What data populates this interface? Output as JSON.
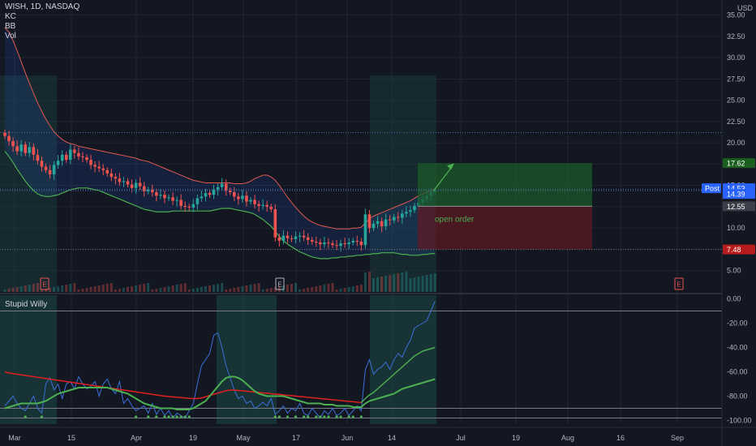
{
  "header": {
    "title": "WISH, 1D, NASDAQ",
    "indicators": [
      "KC",
      "BB",
      "Vol"
    ],
    "currency": "USD"
  },
  "oscillator": {
    "title": "Stupid Willy"
  },
  "annotations": {
    "open_order": "open order",
    "earnings_marker": "E"
  },
  "colors": {
    "background": "#131722",
    "up": "#26a69a",
    "down": "#ef5350",
    "bb_upper": "#e05a4f",
    "kc_lower": "#4caf50",
    "willy_line": "#3a6fd8",
    "willy_ma_red": "#e02020",
    "willy_ma_green": "#4caf50",
    "profit_zone": "#1c5a2a",
    "loss_zone": "#5c1a22",
    "tag_last": "#2962ff",
    "tag_target": "#1b5e20",
    "tag_stop": "#b71c1c",
    "tag_entry": "#3b3f49"
  },
  "chart_data": [
    {
      "type": "candlestick",
      "title": "WISH, 1D, NASDAQ",
      "ylabel": "USD",
      "ylim": [
        2.5,
        36
      ],
      "x_tick_labels": [
        "Mar",
        "15",
        "Apr",
        "19",
        "May",
        "17",
        "Jun",
        "14",
        "Jul",
        "19",
        "Aug",
        "16",
        "Sep"
      ],
      "y_tick_labels": [
        "35.00",
        "32.50",
        "30.00",
        "27.50",
        "25.00",
        "22.50",
        "20.00",
        "17.50",
        "15.00",
        "12.50",
        "10.00",
        "7.50",
        "5.00"
      ],
      "price_tags": [
        {
          "label": "Post",
          "value": "14.53"
        },
        {
          "label": "",
          "value": "14.39"
        },
        {
          "label": "",
          "value": "17.62"
        },
        {
          "label": "",
          "value": "12.55"
        },
        {
          "label": "",
          "value": "7.48"
        }
      ],
      "close": [
        20.8,
        20.2,
        19.6,
        19.0,
        19.8,
        18.8,
        19.5,
        18.6,
        17.9,
        17.2,
        16.8,
        16.3,
        17.4,
        17.9,
        18.6,
        18.0,
        19.2,
        18.8,
        18.4,
        18.3,
        18.0,
        17.4,
        17.2,
        17.0,
        16.8,
        16.4,
        16.0,
        15.8,
        15.4,
        15.5,
        15.1,
        14.7,
        15.3,
        14.9,
        14.3,
        14.5,
        14.2,
        13.8,
        13.9,
        13.5,
        13.6,
        13.2,
        13.3,
        12.6,
        12.5,
        12.4,
        12.8,
        13.5,
        13.7,
        14.1,
        13.9,
        14.5,
        14.8,
        15.2,
        14.4,
        14.2,
        13.7,
        13.4,
        13.8,
        13.1,
        13.3,
        12.8,
        12.6,
        12.7,
        12.5,
        12.2,
        8.9,
        8.5,
        9.1,
        8.8,
        8.7,
        9.0,
        9.1,
        8.9,
        8.6,
        8.4,
        8.3,
        8.1,
        8.3,
        8.2,
        8.0,
        7.9,
        8.2,
        8.1,
        8.3,
        8.5,
        8.4,
        8.0,
        11.6,
        10.0,
        10.5,
        10.8,
        10.2,
        11.0,
        10.9,
        11.3,
        11.2,
        11.7,
        11.9,
        12.1,
        12.6,
        13.0,
        13.4,
        13.8,
        14.2,
        14.39
      ],
      "bb_upper": [
        33.5,
        33.0,
        32.0,
        30.8,
        29.5,
        28.2,
        27.0,
        25.8,
        24.7,
        23.7,
        22.8,
        22.0,
        21.3,
        20.8,
        20.4,
        20.1,
        19.9,
        19.8,
        19.6,
        19.5,
        19.4,
        19.3,
        19.2,
        19.1,
        19.0,
        18.9,
        18.8,
        18.7,
        18.6,
        18.5,
        18.4,
        18.3,
        18.2,
        18.0,
        17.9,
        17.8,
        17.6,
        17.4,
        17.2,
        17.0,
        16.8,
        16.6,
        16.4,
        16.2,
        16.0,
        15.8,
        15.6,
        15.5,
        15.4,
        15.3,
        15.3,
        15.3,
        15.3,
        15.3,
        15.3,
        15.3,
        15.2,
        15.2,
        15.2,
        15.3,
        15.5,
        15.8,
        16.0,
        16.2,
        16.2,
        16.0,
        15.6,
        15.0,
        14.3,
        13.6,
        13.0,
        12.4,
        11.9,
        11.4,
        11.0,
        10.7,
        10.5,
        10.3,
        10.2,
        10.1,
        10.0,
        9.9,
        9.9,
        9.9,
        9.9,
        10.0,
        10.0,
        10.1,
        10.6,
        11.1,
        11.4,
        11.6,
        11.8,
        12.0,
        12.2,
        12.4,
        12.6,
        12.8,
        13.0,
        13.2,
        13.5,
        13.8,
        14.0,
        14.2,
        14.4,
        14.6
      ],
      "kc_lower": [
        19.0,
        18.4,
        17.7,
        16.9,
        16.2,
        15.5,
        14.9,
        14.4,
        14.0,
        13.8,
        13.7,
        13.7,
        13.8,
        13.9,
        14.1,
        14.3,
        14.5,
        14.6,
        14.7,
        14.7,
        14.7,
        14.6,
        14.5,
        14.4,
        14.2,
        14.0,
        13.8,
        13.6,
        13.4,
        13.2,
        13.0,
        12.8,
        12.6,
        12.4,
        12.2,
        12.1,
        12.0,
        11.9,
        11.9,
        11.9,
        11.9,
        12.0,
        12.0,
        12.0,
        12.0,
        12.0,
        12.0,
        12.0,
        12.0,
        12.0,
        12.0,
        12.1,
        12.2,
        12.3,
        12.3,
        12.3,
        12.2,
        12.1,
        12.0,
        11.9,
        11.8,
        11.6,
        11.3,
        11.0,
        10.6,
        10.2,
        9.6,
        9.0,
        8.5,
        8.1,
        7.8,
        7.5,
        7.2,
        7.0,
        6.8,
        6.6,
        6.5,
        6.4,
        6.4,
        6.4,
        6.5,
        6.5,
        6.6,
        6.6,
        6.7,
        6.7,
        6.8,
        6.8,
        6.9,
        6.9,
        7.0,
        7.0,
        7.1,
        7.1,
        7.1,
        7.1,
        7.0,
        6.9,
        6.9,
        6.8,
        6.8,
        6.8,
        6.9,
        6.9,
        7.0,
        7.0
      ]
    },
    {
      "type": "line",
      "title": "Stupid Willy",
      "ylim": [
        -103,
        3
      ],
      "y_tick_labels": [
        "0.00",
        "-20.00",
        "-40.00",
        "-60.00",
        "-80.00",
        "-100.00"
      ],
      "series": [
        {
          "values": [
            -88,
            -84,
            -80,
            -86,
            -90,
            -92,
            -86,
            -80,
            -90,
            -94,
            -70,
            -65,
            -75,
            -70,
            -82,
            -70,
            -68,
            -74,
            -64,
            -70,
            -74,
            -72,
            -68,
            -80,
            -70,
            -66,
            -74,
            -78,
            -68,
            -86,
            -82,
            -88,
            -92,
            -90,
            -88,
            -94,
            -86,
            -95,
            -90,
            -96,
            -92,
            -98,
            -94,
            -96,
            -98,
            -92,
            -86,
            -70,
            -55,
            -50,
            -45,
            -30,
            -28,
            -40,
            -55,
            -65,
            -75,
            -82,
            -80,
            -86,
            -84,
            -90,
            -88,
            -85,
            -88,
            -82,
            -95,
            -92,
            -88,
            -94,
            -90,
            -92,
            -86,
            -94,
            -96,
            -90,
            -94,
            -98,
            -92,
            -95,
            -90,
            -96,
            -94,
            -90,
            -96,
            -92,
            -88,
            -92,
            -58,
            -50,
            -62,
            -58,
            -56,
            -52,
            -58,
            -50,
            -45,
            -48,
            -40,
            -34,
            -24,
            -22,
            -20,
            -18,
            -10,
            -2
          ]
        },
        {
          "values": [
            -90,
            -89,
            -88,
            -87,
            -86,
            -86,
            -86,
            -86,
            -86,
            -85,
            -84,
            -82,
            -80,
            -78,
            -77,
            -76,
            -75,
            -74,
            -73,
            -73,
            -73,
            -73,
            -73,
            -73,
            -73,
            -73,
            -74,
            -75,
            -76,
            -77,
            -78,
            -80,
            -82,
            -84,
            -86,
            -87,
            -88,
            -89,
            -90,
            -90,
            -90,
            -90,
            -91,
            -91,
            -91,
            -91,
            -90,
            -88,
            -86,
            -84,
            -80,
            -76,
            -72,
            -68,
            -65,
            -64,
            -64,
            -65,
            -67,
            -70,
            -73,
            -76,
            -78,
            -79,
            -80,
            -80,
            -80,
            -80,
            -80,
            -81,
            -82,
            -83,
            -84,
            -85,
            -86,
            -86,
            -86,
            -86,
            -87,
            -87,
            -87,
            -88,
            -88,
            -88,
            -88,
            -89,
            -89,
            -89,
            -86,
            -84,
            -83,
            -82,
            -81,
            -80,
            -79,
            -78,
            -76,
            -74,
            -73,
            -72,
            -71,
            -70,
            -69,
            -68,
            -67,
            -66
          ]
        },
        {
          "values": [
            -60,
            -61,
            -61.5,
            -62,
            -62.5,
            -63,
            -63.5,
            -64,
            -64.5,
            -65,
            -65.5,
            -66,
            -66.5,
            -67,
            -67.5,
            -68,
            -68.5,
            -69,
            -69.5,
            -70,
            -70.5,
            -71,
            -71.5,
            -72,
            -72.5,
            -73,
            -73.5,
            -74,
            -74.5,
            -75,
            -75.5,
            -76,
            -76.5,
            -77,
            -77.5,
            -78,
            -78.5,
            -79,
            -79.5,
            -80,
            -80.3,
            -80.6,
            -80.9,
            -81.2,
            -81.5,
            -81.8,
            -82,
            -82,
            -81.5,
            -80.5,
            -79.5,
            -78.5,
            -77.5,
            -76.5,
            -75.5,
            -75,
            -75,
            -75.3,
            -75.6,
            -76,
            -76.3,
            -76.6,
            -77,
            -77.3,
            -77.6,
            -78,
            -78.3,
            -78.6,
            -79,
            -79.3,
            -79.6,
            -80,
            -80.3,
            -80.6,
            -81,
            -81.3,
            -81.6,
            -82,
            -82.3,
            -82.6,
            -83,
            -83.3,
            -83.6,
            -84,
            -84.3,
            -84.6,
            -85,
            -85.3,
            -82,
            -79,
            -77,
            -74,
            -71,
            -68,
            -65,
            -62,
            -59,
            -56,
            -53,
            -50,
            -47,
            -45,
            -43,
            -42,
            -41,
            -40
          ]
        }
      ]
    }
  ]
}
